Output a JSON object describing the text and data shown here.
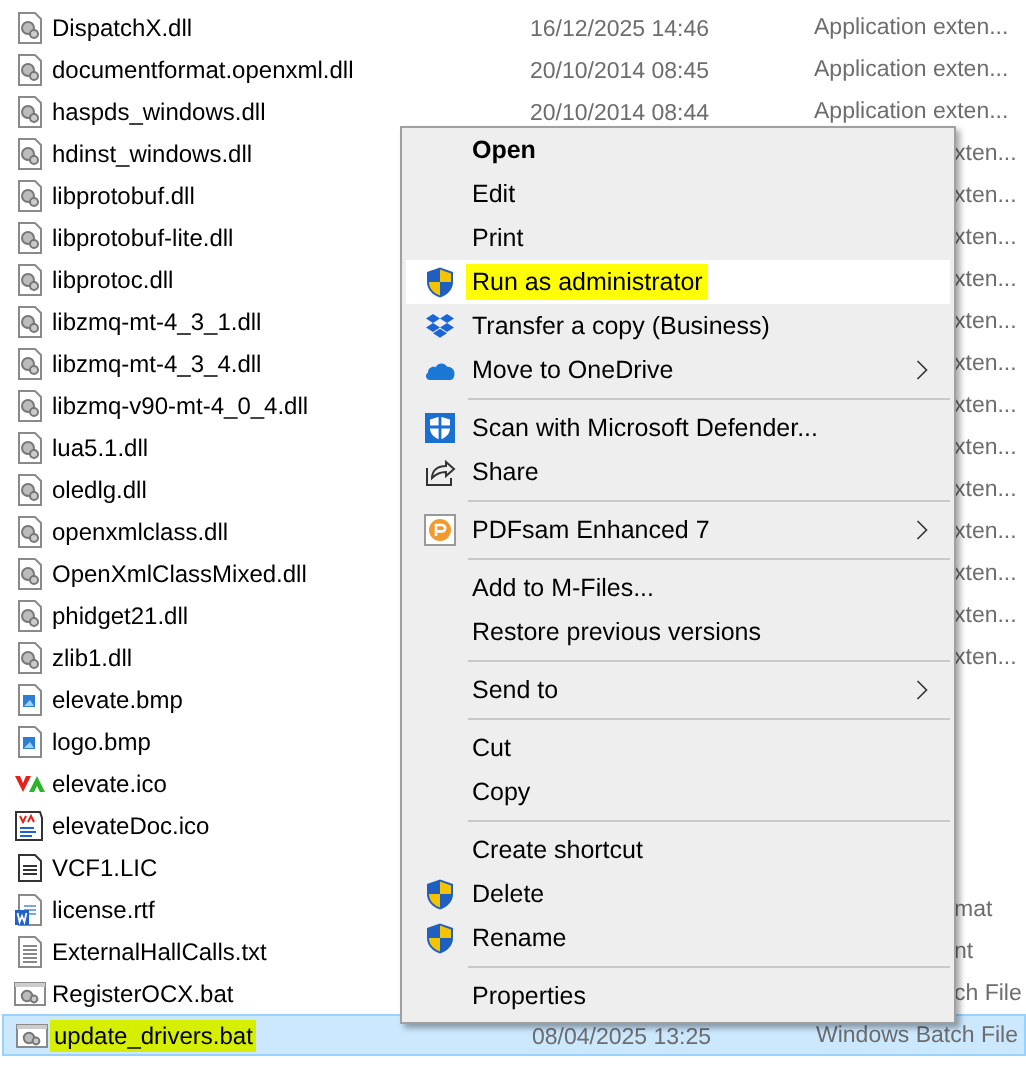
{
  "files": [
    {
      "name": "DispatchX.dll",
      "kind": "dll",
      "date": "16/12/2025 14:46",
      "type": "Application exten...",
      "selected": false
    },
    {
      "name": "documentformat.openxml.dll",
      "kind": "dll",
      "date": "20/10/2014 08:45",
      "type": "Application exten...",
      "selected": false
    },
    {
      "name": "haspds_windows.dll",
      "kind": "dll",
      "date": "20/10/2014 08:44",
      "type": "Application exten...",
      "selected": false
    },
    {
      "name": "hdinst_windows.dll",
      "kind": "dll",
      "type": "xten...",
      "covered": true,
      "selected": false
    },
    {
      "name": "libprotobuf.dll",
      "kind": "dll",
      "type": "xten...",
      "covered": true,
      "selected": false
    },
    {
      "name": "libprotobuf-lite.dll",
      "kind": "dll",
      "type": "xten...",
      "covered": true,
      "selected": false
    },
    {
      "name": "libprotoc.dll",
      "kind": "dll",
      "type": "xten...",
      "covered": true,
      "selected": false
    },
    {
      "name": "libzmq-mt-4_3_1.dll",
      "kind": "dll",
      "type": "xten...",
      "covered": true,
      "selected": false
    },
    {
      "name": "libzmq-mt-4_3_4.dll",
      "kind": "dll",
      "type": "xten...",
      "covered": true,
      "selected": false
    },
    {
      "name": "libzmq-v90-mt-4_0_4.dll",
      "kind": "dll",
      "type": "xten...",
      "covered": true,
      "selected": false
    },
    {
      "name": "lua5.1.dll",
      "kind": "dll",
      "type": "xten...",
      "covered": true,
      "selected": false
    },
    {
      "name": "oledlg.dll",
      "kind": "dll",
      "type": "xten...",
      "covered": true,
      "selected": false
    },
    {
      "name": "openxmlclass.dll",
      "kind": "dll",
      "type": "xten...",
      "covered": true,
      "selected": false
    },
    {
      "name": "OpenXmlClassMixed.dll",
      "kind": "dll",
      "type": "xten...",
      "covered": true,
      "selected": false
    },
    {
      "name": "phidget21.dll",
      "kind": "dll",
      "type": "xten...",
      "covered": true,
      "selected": false
    },
    {
      "name": "zlib1.dll",
      "kind": "dll",
      "type": "xten...",
      "covered": true,
      "selected": false
    },
    {
      "name": "elevate.bmp",
      "kind": "bmp",
      "selected": false
    },
    {
      "name": "logo.bmp",
      "kind": "bmp",
      "selected": false
    },
    {
      "name": "elevate.ico",
      "kind": "ico",
      "selected": false
    },
    {
      "name": "elevateDoc.ico",
      "kind": "icodoc",
      "selected": false
    },
    {
      "name": "VCF1.LIC",
      "kind": "lic",
      "selected": false
    },
    {
      "name": "license.rtf",
      "kind": "rtf",
      "type": "mat",
      "covered": true,
      "selected": false
    },
    {
      "name": "ExternalHallCalls.txt",
      "kind": "txt",
      "type": "nt",
      "covered": true,
      "selected": false
    },
    {
      "name": "RegisterOCX.bat",
      "kind": "bat",
      "type": "ch File",
      "covered": true,
      "selected": false
    },
    {
      "name": "update_drivers.bat",
      "kind": "bat",
      "date": "08/04/2025 13:25",
      "type": "Windows Batch File",
      "selected": true,
      "highlighted": true
    }
  ],
  "context_menu": [
    {
      "kind": "item",
      "label": "Open",
      "default": true
    },
    {
      "kind": "item",
      "label": "Edit"
    },
    {
      "kind": "item",
      "label": "Print"
    },
    {
      "kind": "uac",
      "label": "Run as administrator",
      "hovered": true,
      "highlighted": true
    },
    {
      "kind": "dropbox",
      "label": "Transfer a copy (Business)"
    },
    {
      "kind": "onedrive",
      "label": "Move to OneDrive",
      "submenu": true
    },
    {
      "kind": "separator"
    },
    {
      "kind": "defender",
      "label": "Scan with Microsoft Defender..."
    },
    {
      "kind": "share",
      "label": "Share"
    },
    {
      "kind": "separator"
    },
    {
      "kind": "pdfsam",
      "label": "PDFsam Enhanced 7",
      "submenu": true
    },
    {
      "kind": "separator"
    },
    {
      "kind": "item",
      "label": "Add to M-Files..."
    },
    {
      "kind": "item",
      "label": "Restore previous versions"
    },
    {
      "kind": "separator"
    },
    {
      "kind": "item",
      "label": "Send to",
      "submenu": true
    },
    {
      "kind": "separator"
    },
    {
      "kind": "item",
      "label": "Cut"
    },
    {
      "kind": "item",
      "label": "Copy"
    },
    {
      "kind": "separator"
    },
    {
      "kind": "item",
      "label": "Create shortcut"
    },
    {
      "kind": "uac",
      "label": "Delete"
    },
    {
      "kind": "uac",
      "label": "Rename"
    },
    {
      "kind": "separator"
    },
    {
      "kind": "item",
      "label": "Properties"
    }
  ]
}
